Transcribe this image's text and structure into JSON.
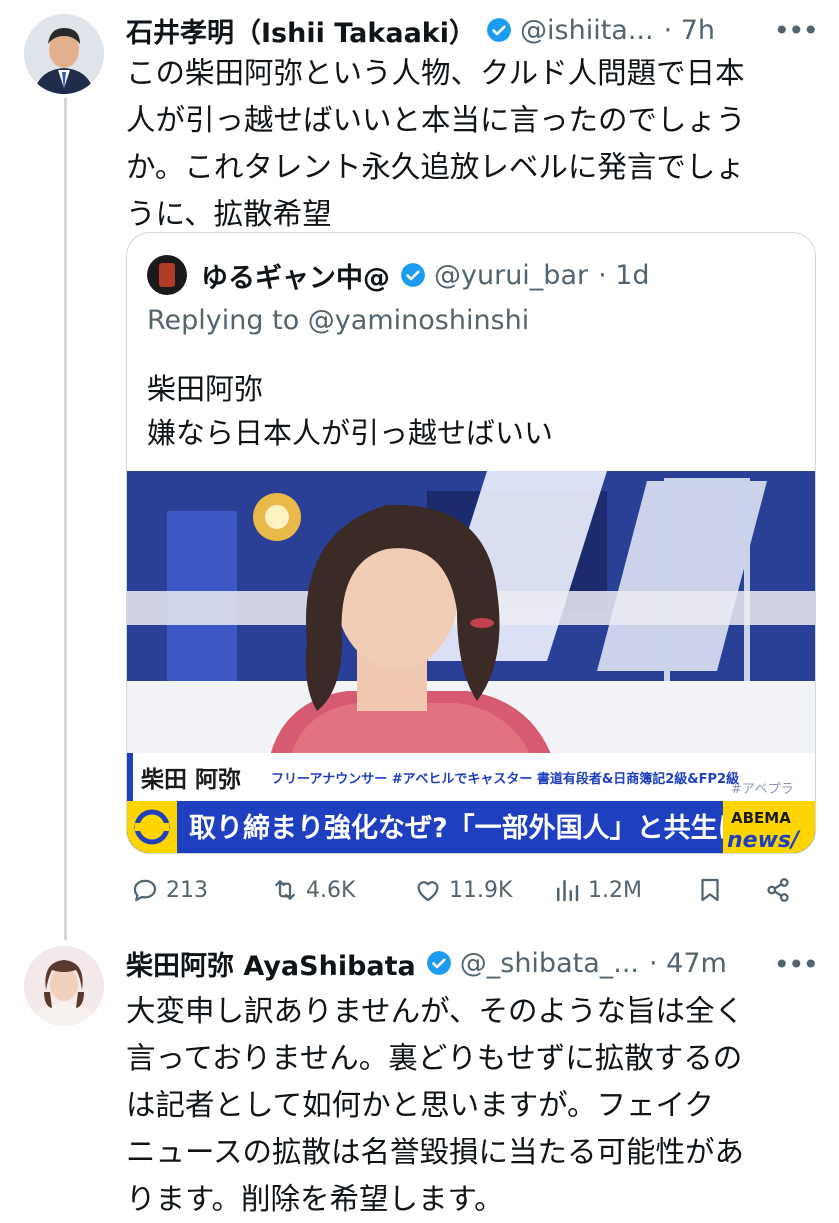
{
  "tweet1": {
    "name": "石井孝明（Ishii Takaaki）",
    "handle": "@ishiita...",
    "time": "· 7h",
    "text": "この柴田阿弥という人物、クルド人問題で日本\n人が引っ越せばいいと本当に言ったのでしょう\nか。これタレント永久追放レベルに発言でしょ\nうに、拡散希望",
    "quote": {
      "name": "ゆるギャン中@",
      "handle": "@yurui_bar",
      "time": "· 1d",
      "replying": "Replying to @yaminoshinshi",
      "text": "柴田阿弥\n嫌なら日本人が引っ越せばいい",
      "media": {
        "caption_name": "柴田 阿弥",
        "caption_role": "フリーアナウンサー #アベヒルでキャスター 書道有段者&日商簿記2級&FP2級",
        "watermark": "#アベプラ",
        "headline": "取り締まり強化なぜ?「一部外国人」と共生は",
        "brand_top": "ABEMA",
        "brand_bottom": "news/"
      }
    },
    "stats": {
      "replies": "213",
      "reposts": "4.6K",
      "likes": "11.9K",
      "views": "1.2M"
    }
  },
  "tweet2": {
    "name": "柴田阿弥 AyaShibata",
    "handle": "@_shibata_...",
    "time": "· 47m",
    "text": "大変申し訳ありませんが、そのような旨は全く\n言っておりません。裏どりもせずに拡散するの\nは記者として如何かと思いますが。フェイク\nニュースの拡散は名誉毀損に当たる可能性があ\nります。削除を希望します。"
  },
  "colors": {
    "accent": "#1d9bf0",
    "text": "#0f1419",
    "muted": "#536471",
    "border": "#cfd9de",
    "news_band": "#1e3fbf",
    "brand_yellow": "#ffd500"
  },
  "icons": [
    "more-icon",
    "verified-badge-icon",
    "reply-icon",
    "repost-icon",
    "like-icon",
    "views-icon",
    "bookmark-icon",
    "share-icon"
  ]
}
